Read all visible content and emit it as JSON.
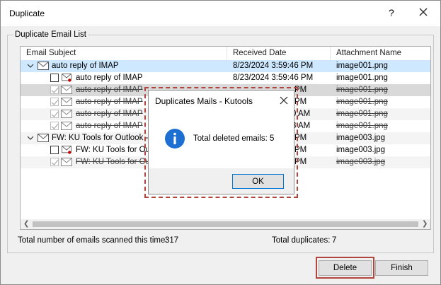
{
  "window": {
    "title": "Duplicate",
    "help_label": "?"
  },
  "group": {
    "label": "Duplicate Email List"
  },
  "columns": {
    "subject": "Email Subject",
    "received": "Received Date",
    "attachment": "Attachment Name"
  },
  "rows": [
    {
      "subject": "auto reply of IMAP",
      "date": "8/23/2024 3:59:46 PM",
      "attach": "image001.png"
    },
    {
      "subject": "auto reply of IMAP",
      "date": "8/23/2024 3:59:46 PM",
      "attach": "image001.png"
    },
    {
      "subject": "auto reply of IMAP",
      "date": "PM",
      "attach": "image001.png"
    },
    {
      "subject": "auto reply of IMAP",
      "date": "PM",
      "attach": "image001.png"
    },
    {
      "subject": "auto reply of IMAP",
      "date": "0 AM",
      "attach": "image001.png"
    },
    {
      "subject": "auto reply of IMAP",
      "date": "3 AM",
      "attach": "image001.png"
    },
    {
      "subject": "FW: KU Tools for Outlook -",
      "date": "PM",
      "attach": "image003.jpg"
    },
    {
      "subject": "FW: KU Tools for Out",
      "date": "PM",
      "attach": "image003.jpg"
    },
    {
      "subject": "FW: KU Tools for Out",
      "date": "PM",
      "attach": "image003.jpg"
    }
  ],
  "status": {
    "scanned_label": "Total number of emails scanned this time:",
    "scanned_value": "317",
    "dup_label": "Total duplicates:",
    "dup_value": "7"
  },
  "buttons": {
    "delete": "Delete",
    "finish": "Finish"
  },
  "popup": {
    "title": "Duplicates Mails - Kutools",
    "message": "Total deleted emails: 5",
    "ok": "OK"
  }
}
